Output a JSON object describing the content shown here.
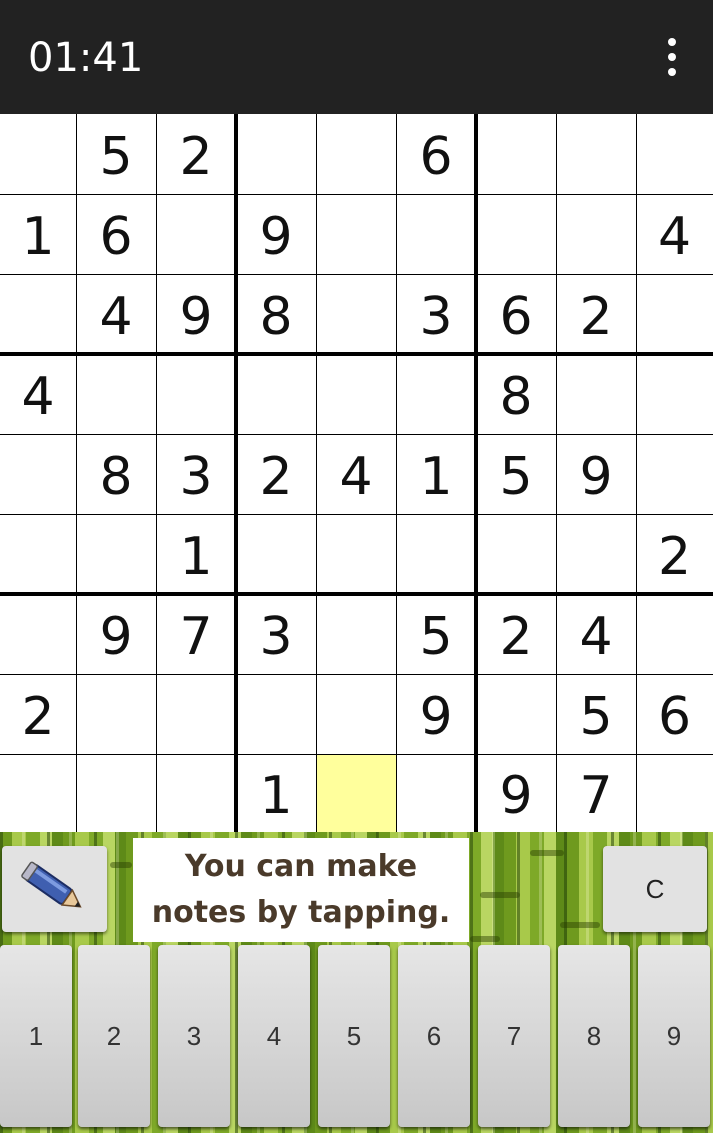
{
  "header": {
    "timer": "01:41"
  },
  "board": {
    "rows": [
      [
        "",
        "5",
        "2",
        "",
        "",
        "6",
        "",
        "",
        ""
      ],
      [
        "1",
        "6",
        "",
        "9",
        "",
        "",
        "",
        "",
        "4"
      ],
      [
        "",
        "4",
        "9",
        "8",
        "",
        "3",
        "6",
        "2",
        ""
      ],
      [
        "4",
        "",
        "",
        "",
        "",
        "",
        "8",
        "",
        ""
      ],
      [
        "",
        "8",
        "3",
        "2",
        "4",
        "1",
        "5",
        "9",
        ""
      ],
      [
        "",
        "",
        "1",
        "",
        "",
        "",
        "",
        "",
        "2"
      ],
      [
        "",
        "9",
        "7",
        "3",
        "",
        "5",
        "2",
        "4",
        ""
      ],
      [
        "2",
        "",
        "",
        "",
        "",
        "9",
        "",
        "5",
        "6"
      ],
      [
        "",
        "",
        "",
        "1",
        "",
        "",
        "9",
        "7",
        ""
      ]
    ],
    "selected_cell": {
      "row": 8,
      "col": 4
    },
    "selected_color": "#ffff9c"
  },
  "controls": {
    "pencil_icon": "pencil-icon",
    "hint_line1": "You can make",
    "hint_line2": "notes by tapping.",
    "clear_label": "C",
    "keys": [
      "1",
      "2",
      "3",
      "4",
      "5",
      "6",
      "7",
      "8",
      "9"
    ]
  }
}
